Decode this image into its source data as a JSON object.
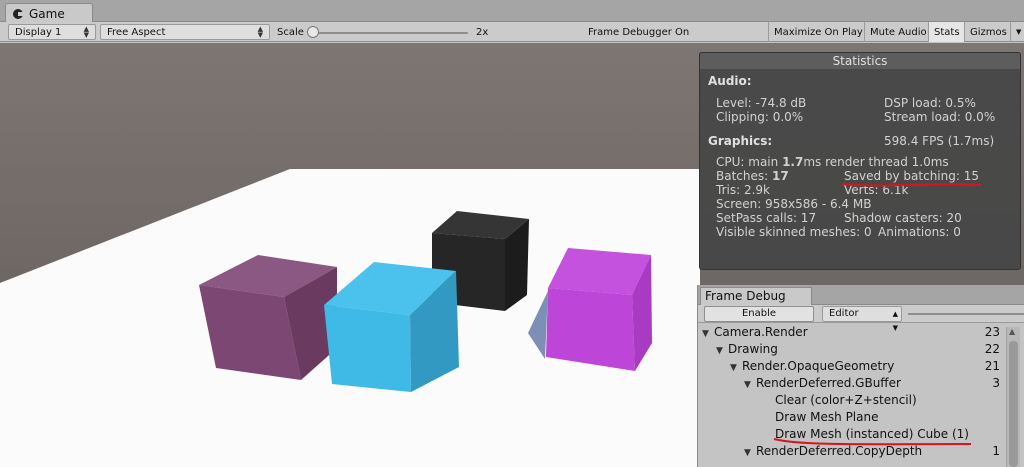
{
  "tab": {
    "label": "Game"
  },
  "toolbar": {
    "display": "Display 1",
    "aspect": "Free Aspect",
    "scale_label": "Scale",
    "scale_value": "2x",
    "frame_debugger_status": "Frame Debugger On",
    "maximize_on_play": "Maximize On Play",
    "mute_audio": "Mute Audio",
    "stats": "Stats",
    "gizmos": "Gizmos"
  },
  "statistics": {
    "title": "Statistics",
    "audio_heading": "Audio:",
    "level": "Level: -74.8 dB",
    "dsp_load": "DSP load: 0.5%",
    "clipping": "Clipping: 0.0%",
    "stream_load": "Stream load: 0.0%",
    "graphics_heading": "Graphics:",
    "fps": "598.4 FPS (1.7ms)",
    "cpu_prefix": "CPU: main ",
    "cpu_main": "1.7",
    "cpu_suffix": "ms  render thread 1.0ms",
    "batches_prefix": "Batches: ",
    "batches": "17",
    "saved_by_batching": "Saved by batching: 15",
    "tris": "Tris: 2.9k",
    "verts": "Verts: 6.1k",
    "screen": "Screen: 958x586 - 6.4 MB",
    "setpass": "SetPass calls: 17",
    "shadow_casters": "Shadow casters: 20",
    "skinned": "Visible skinned meshes: 0",
    "animations": "Animations: 0"
  },
  "frame_debug": {
    "tab": "Frame Debug",
    "enable": "Enable",
    "target": "Editor",
    "tree": [
      {
        "label": "Camera.Render",
        "count": "23"
      },
      {
        "label": "Drawing",
        "count": "22"
      },
      {
        "label": "Render.OpaqueGeometry",
        "count": "21"
      },
      {
        "label": "RenderDeferred.GBuffer",
        "count": "3"
      },
      {
        "label": "Clear (color+Z+stencil)",
        "count": ""
      },
      {
        "label": "Draw Mesh Plane",
        "count": ""
      },
      {
        "label": "Draw Mesh (instanced) Cube (1)",
        "count": ""
      },
      {
        "label": "RenderDeferred.CopyDepth",
        "count": "1"
      }
    ]
  },
  "colors": {
    "cube_purple": "#7d4773",
    "cube_cyan": "#3fb9e6",
    "cube_black": "#262626",
    "cube_magenta": "#bd45d8",
    "annotation_red": "#d8141e"
  }
}
